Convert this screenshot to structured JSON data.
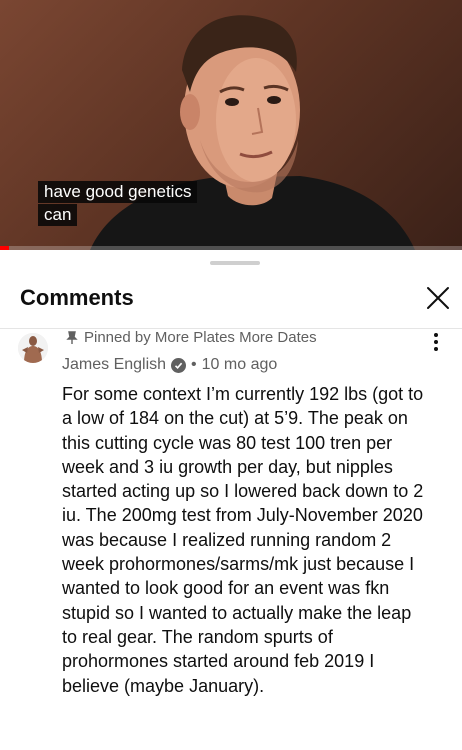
{
  "video": {
    "captions": [
      "have good genetics",
      "can"
    ],
    "progress": 0.02,
    "colors": {
      "progress_fill": "#ff0000",
      "caption_bg": "#080808"
    }
  },
  "comments_panel": {
    "title": "Comments",
    "close_icon": "close-icon",
    "pinned_comment": {
      "pinned_label": "Pinned by More Plates More Dates",
      "author": "James English",
      "verified_icon": "verified-check-icon",
      "separator": "•",
      "time": "10 mo ago",
      "menu_icon": "more-vert-icon",
      "lines": [
        "For some context I’m currently 192 lbs (got to",
        "a low of 184 on the cut) at 5’9. The peak on",
        "this cutting cycle was 80 test 100 tren per",
        "week and 3 iu growth per day, but nipples",
        "started acting up so I lowered back down to 2",
        "iu. The 200mg test from July-November 2020",
        "was because I realized running random 2",
        "week prohormones/sarms/mk just because I",
        "wanted to look good for an event was fkn",
        "stupid so I wanted to actually make the leap",
        "to real gear. The random spurts of",
        "prohormones started around feb 2019 I",
        "believe (maybe January)."
      ]
    }
  }
}
